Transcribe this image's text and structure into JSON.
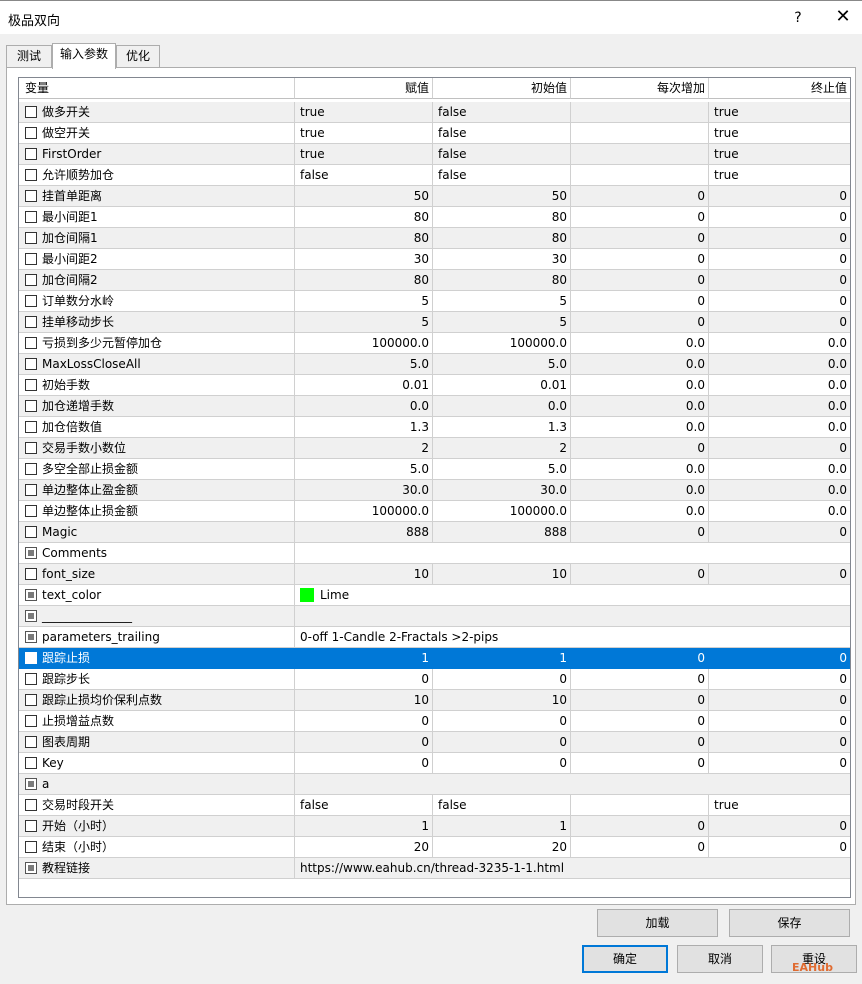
{
  "window": {
    "title": "极品双向",
    "help": "?",
    "close": "✕"
  },
  "tabs": [
    "测试",
    "输入参数",
    "优化"
  ],
  "table": {
    "columns": [
      "变量",
      "赋值",
      "初始值",
      "每次增加",
      "终止值"
    ],
    "rows": [
      {
        "name": "做多开关",
        "value": "true",
        "start": "false",
        "step": "",
        "stop": "true",
        "type": "text"
      },
      {
        "name": "做空开关",
        "value": "true",
        "start": "false",
        "step": "",
        "stop": "true",
        "type": "text"
      },
      {
        "name": "FirstOrder",
        "value": "true",
        "start": "false",
        "step": "",
        "stop": "true",
        "type": "text"
      },
      {
        "name": "允许顺势加仓",
        "value": "false",
        "start": "false",
        "step": "",
        "stop": "true",
        "type": "text"
      },
      {
        "name": "挂首单距离",
        "value": "50",
        "start": "50",
        "step": "0",
        "stop": "0",
        "type": "num"
      },
      {
        "name": "最小间距1",
        "value": "80",
        "start": "80",
        "step": "0",
        "stop": "0",
        "type": "num"
      },
      {
        "name": "加仓间隔1",
        "value": "80",
        "start": "80",
        "step": "0",
        "stop": "0",
        "type": "num"
      },
      {
        "name": "最小间距2",
        "value": "30",
        "start": "30",
        "step": "0",
        "stop": "0",
        "type": "num"
      },
      {
        "name": "加仓间隔2",
        "value": "80",
        "start": "80",
        "step": "0",
        "stop": "0",
        "type": "num"
      },
      {
        "name": "订单数分水岭",
        "value": "5",
        "start": "5",
        "step": "0",
        "stop": "0",
        "type": "num"
      },
      {
        "name": "挂单移动步长",
        "value": "5",
        "start": "5",
        "step": "0",
        "stop": "0",
        "type": "num"
      },
      {
        "name": "亏损到多少元暂停加仓",
        "value": "100000.0",
        "start": "100000.0",
        "step": "0.0",
        "stop": "0.0",
        "type": "num"
      },
      {
        "name": "MaxLossCloseAll",
        "value": "5.0",
        "start": "5.0",
        "step": "0.0",
        "stop": "0.0",
        "type": "num"
      },
      {
        "name": "初始手数",
        "value": "0.01",
        "start": "0.01",
        "step": "0.0",
        "stop": "0.0",
        "type": "num"
      },
      {
        "name": "加仓递增手数",
        "value": "0.0",
        "start": "0.0",
        "step": "0.0",
        "stop": "0.0",
        "type": "num"
      },
      {
        "name": "加仓倍数值",
        "value": "1.3",
        "start": "1.3",
        "step": "0.0",
        "stop": "0.0",
        "type": "num"
      },
      {
        "name": "交易手数小数位",
        "value": "2",
        "start": "2",
        "step": "0",
        "stop": "0",
        "type": "num"
      },
      {
        "name": "多空全部止损金额",
        "value": "5.0",
        "start": "5.0",
        "step": "0.0",
        "stop": "0.0",
        "type": "num"
      },
      {
        "name": "单边整体止盈金额",
        "value": "30.0",
        "start": "30.0",
        "step": "0.0",
        "stop": "0.0",
        "type": "num"
      },
      {
        "name": "单边整体止损金额",
        "value": "100000.0",
        "start": "100000.0",
        "step": "0.0",
        "stop": "0.0",
        "type": "num"
      },
      {
        "name": "Magic",
        "value": "888",
        "start": "888",
        "step": "0",
        "stop": "0",
        "type": "num"
      },
      {
        "name": "Comments",
        "value": "",
        "type": "wide",
        "disabled": true
      },
      {
        "name": "font_size",
        "value": "10",
        "start": "10",
        "step": "0",
        "stop": "0",
        "type": "num"
      },
      {
        "name": "text_color",
        "value": "Lime",
        "type": "color",
        "disabled": true
      },
      {
        "name": "_______________",
        "value": "",
        "type": "wide",
        "disabled": true
      },
      {
        "name": "parameters_trailing",
        "value": "0-off  1-Candle  2-Fractals  >2-pips",
        "type": "wide",
        "disabled": true
      },
      {
        "name": "跟踪止损",
        "value": "1",
        "start": "1",
        "step": "0",
        "stop": "0",
        "type": "num",
        "selected": true
      },
      {
        "name": "跟踪步长",
        "value": "0",
        "start": "0",
        "step": "0",
        "stop": "0",
        "type": "num"
      },
      {
        "name": "跟踪止损均价保利点数",
        "value": "10",
        "start": "10",
        "step": "0",
        "stop": "0",
        "type": "num"
      },
      {
        "name": "止损增益点数",
        "value": "0",
        "start": "0",
        "step": "0",
        "stop": "0",
        "type": "num"
      },
      {
        "name": "图表周期",
        "value": "0",
        "start": "0",
        "step": "0",
        "stop": "0",
        "type": "num"
      },
      {
        "name": "Key",
        "value": "0",
        "start": "0",
        "step": "0",
        "stop": "0",
        "type": "num"
      },
      {
        "name": "a",
        "value": "",
        "type": "wide",
        "disabled": true
      },
      {
        "name": "交易时段开关",
        "value": "false",
        "start": "false",
        "step": "",
        "stop": "true",
        "type": "text"
      },
      {
        "name": "开始（小时）",
        "value": "1",
        "start": "1",
        "step": "0",
        "stop": "0",
        "type": "num"
      },
      {
        "name": "结束（小时）",
        "value": "20",
        "start": "20",
        "step": "0",
        "stop": "0",
        "type": "num"
      },
      {
        "name": "教程链接",
        "value": "https://www.eahub.cn/thread-3235-1-1.html",
        "type": "wide",
        "disabled": true
      }
    ]
  },
  "buttons": {
    "load": "加载",
    "save": "保存",
    "ok": "确定",
    "cancel": "取消",
    "reset": "重设"
  },
  "watermark": "EAHub",
  "colors": {
    "selection": "#0078d7",
    "swatch_lime": "#00ff00"
  }
}
